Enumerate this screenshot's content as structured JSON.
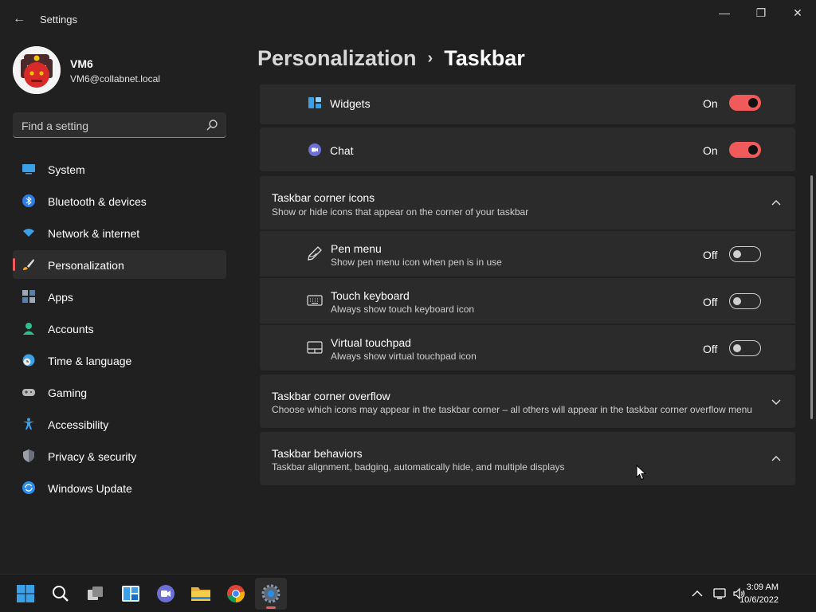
{
  "window": {
    "title": "Settings",
    "back_glyph": "←",
    "minimize_glyph": "—",
    "maximize_glyph": "❐",
    "close_glyph": "✕"
  },
  "profile": {
    "name": "VM6",
    "email": "VM6@collabnet.local"
  },
  "search": {
    "placeholder": "Find a setting"
  },
  "sidebar": {
    "items": [
      {
        "label": "System",
        "icon": "monitor-icon"
      },
      {
        "label": "Bluetooth & devices",
        "icon": "bluetooth-icon"
      },
      {
        "label": "Network & internet",
        "icon": "wifi-icon"
      },
      {
        "label": "Personalization",
        "icon": "brush-icon",
        "active": true
      },
      {
        "label": "Apps",
        "icon": "apps-icon"
      },
      {
        "label": "Accounts",
        "icon": "person-icon"
      },
      {
        "label": "Time & language",
        "icon": "globe-clock-icon"
      },
      {
        "label": "Gaming",
        "icon": "gamepad-icon"
      },
      {
        "label": "Accessibility",
        "icon": "accessibility-icon"
      },
      {
        "label": "Privacy & security",
        "icon": "shield-icon"
      },
      {
        "label": "Windows Update",
        "icon": "refresh-icon"
      }
    ]
  },
  "breadcrumb": {
    "parent": "Personalization",
    "separator": "›",
    "current": "Taskbar"
  },
  "taskbar_items": {
    "widgets": {
      "label": "Widgets",
      "state": "On",
      "enabled": true
    },
    "chat": {
      "label": "Chat",
      "state": "On",
      "enabled": true
    }
  },
  "corner_icons": {
    "title": "Taskbar corner icons",
    "description": "Show or hide icons that appear on the corner of your taskbar",
    "expanded": true,
    "items": [
      {
        "label": "Pen menu",
        "description": "Show pen menu icon when pen is in use",
        "state": "Off",
        "enabled": false
      },
      {
        "label": "Touch keyboard",
        "description": "Always show touch keyboard icon",
        "state": "Off",
        "enabled": false
      },
      {
        "label": "Virtual touchpad",
        "description": "Always show virtual touchpad icon",
        "state": "Off",
        "enabled": false
      }
    ]
  },
  "corner_overflow": {
    "title": "Taskbar corner overflow",
    "description": "Choose which icons may appear in the taskbar corner – all others will appear in the taskbar corner overflow menu",
    "expanded": false
  },
  "behaviors": {
    "title": "Taskbar behaviors",
    "description": "Taskbar alignment, badging, automatically hide, and multiple displays",
    "expanded": true
  },
  "system_taskbar": {
    "apps": [
      "start-icon",
      "search-icon",
      "task-view-icon",
      "widgets-icon",
      "teams-chat-icon",
      "file-explorer-icon",
      "chrome-icon",
      "settings-icon"
    ],
    "active_app": "settings-icon",
    "clock": {
      "time": "3:09 AM",
      "date": "10/6/2022"
    }
  },
  "colors": {
    "accent": "#f15a5a",
    "background": "#202020",
    "card": "#2b2b2b"
  }
}
